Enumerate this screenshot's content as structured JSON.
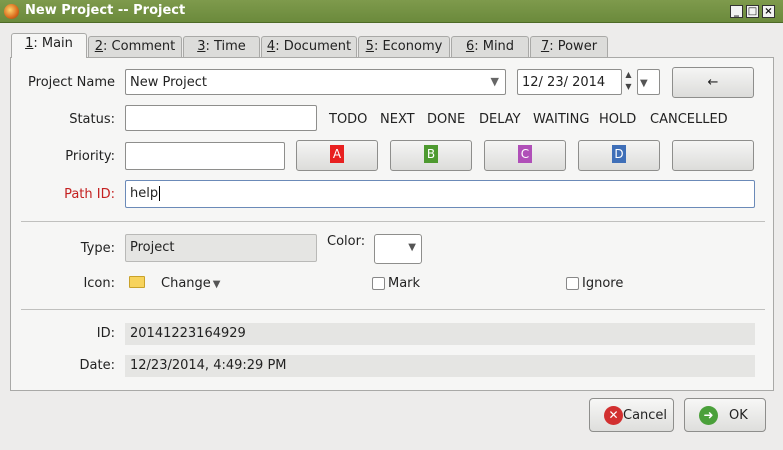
{
  "window": {
    "title": "New Project -- Project"
  },
  "tabs": [
    {
      "key": "1",
      "label": ": Main"
    },
    {
      "key": "2",
      "label": ": Comment"
    },
    {
      "key": "3",
      "label": ": Time"
    },
    {
      "key": "4",
      "label": ": Document"
    },
    {
      "key": "5",
      "label": ": Economy"
    },
    {
      "key": "6",
      "label": ": Mind"
    },
    {
      "key": "7",
      "label": ": Power"
    }
  ],
  "form": {
    "project_name_label": "Project Name",
    "project_name_value": "New Project",
    "date_value": "12/ 23/  2014",
    "back_button": "←",
    "status_label": "Status:",
    "status_options": [
      "TODO",
      "NEXT",
      "DONE",
      "DELAY",
      "WAITING",
      "HOLD",
      "CANCELLED"
    ],
    "priority_label": "Priority:",
    "priority_buttons": [
      {
        "letter": "A",
        "color": "#e82020"
      },
      {
        "letter": "B",
        "color": "#4e9a30"
      },
      {
        "letter": "C",
        "color": "#b04fb8"
      },
      {
        "letter": "D",
        "color": "#3f6fb8"
      }
    ],
    "path_label": "Path ID:",
    "path_value": "help",
    "type_label": "Type:",
    "type_value": "Project",
    "color_label": "Color:",
    "icon_label": "Icon:",
    "change_label": "Change",
    "mark_label": "Mark",
    "ignore_label": "Ignore",
    "id_label": "ID:",
    "id_value": "20141223164929",
    "date_label": "Date:",
    "date_full": "12/23/2014, 4:49:29 PM"
  },
  "buttons": {
    "cancel": "Cancel",
    "ok": "OK"
  },
  "colors": {
    "titlebar": "#6b8a3c",
    "required_label": "#c42020"
  }
}
